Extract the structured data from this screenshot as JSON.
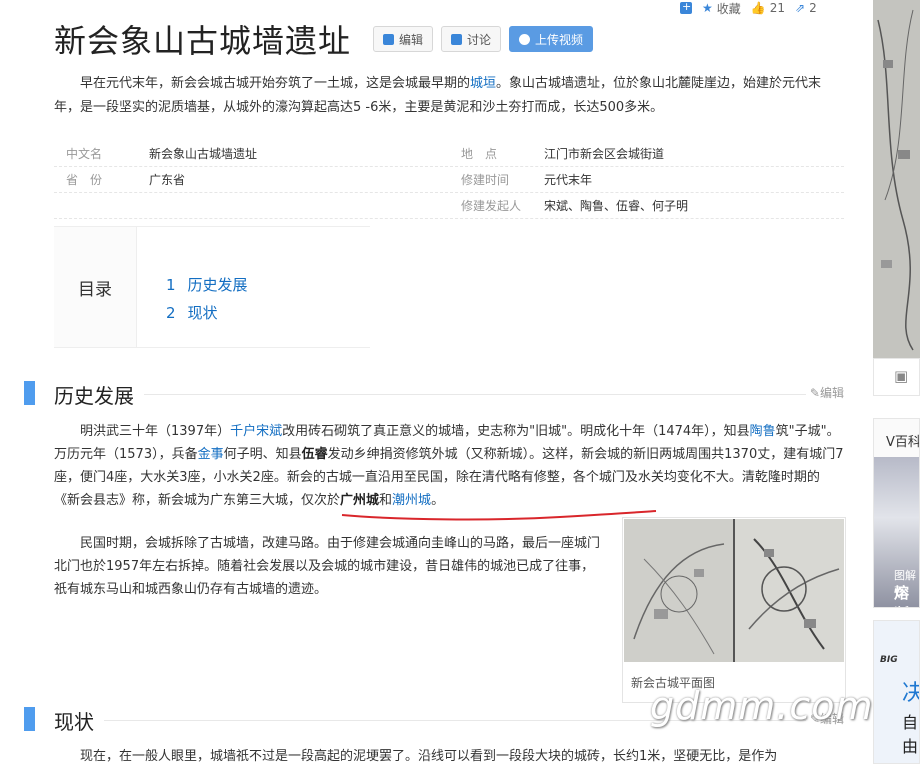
{
  "stats": {
    "favorite_label": "收藏",
    "likes": "21",
    "shares": "2"
  },
  "title": "新会象山古城墙遗址",
  "buttons": {
    "edit": "编辑",
    "discuss": "讨论",
    "upload_video": "上传视频"
  },
  "summary": {
    "before_link": "早在元代末年，新会会城古城开始夯筑了一土城，这是会城最早期的",
    "link": "城垣",
    "after_link": "。象山古城墙遗址，位於象山北麓陡崖边，始建於元代末年，是一段坚实的泥质墙基，从城外的濠沟算起高达5 -6米，主要是黄泥和沙土夯打而成，长达500多米。"
  },
  "info": [
    {
      "k1": "中文名",
      "v1": "新会象山古城墙遗址",
      "k2": "地　点",
      "v2": "江门市新会区会城街道"
    },
    {
      "k1": "省　份",
      "v1": "广东省",
      "k2": "修建时间",
      "v2": "元代末年"
    },
    {
      "k1": "",
      "v1": "",
      "k2": "修建发起人",
      "v2": "宋斌、陶鲁、伍睿、何子明"
    }
  ],
  "toc": {
    "heading": "目录",
    "items": [
      {
        "num": "1",
        "label": "历史发展"
      },
      {
        "num": "2",
        "label": "现状"
      }
    ]
  },
  "sections": {
    "history": "历史发展",
    "status": "现状",
    "edit": "编辑"
  },
  "history_p1": {
    "t1": "明洪武三十年（1397年）",
    "l1": "千户宋斌",
    "t2": "改用砖石砌筑了真正意义的城墙，史志称为\"旧城\"。明成化十年（1474年），知县",
    "l2": "陶鲁",
    "t3": "筑\"子城\"。万历元年（1573），兵备",
    "l3": "金事",
    "t4": "何子明、知县",
    "b1": "伍睿",
    "t5": "发动乡绅捐资修筑外城（又称新城）。这样，新会城的新旧两城周围共1370丈，建有城门7座，便门4座，大水关3座，小水关2座。新会的古城一直沿用至民国，除在清代略有修整，各个城门及水关均变化不大。清乾隆时期的《新会县志》称，新会城为广东第三大城，仅次於",
    "b2": "广州城",
    "t6": "和",
    "l4": "潮州城",
    "t7": "。"
  },
  "history_p2": "民国时期，会城拆除了古城墙，改建马路。由于修建会城通向圭峰山的马路，最后一座城门北门也於1957年左右拆掉。随着社会发展以及会城的城市建设，昔日雄伟的城池已成了往事，祇有城东马山和城西象山仍存有古城墙的遗迹。",
  "figure_caption": "新会古城平面图",
  "status_p1": "现在，在一般人眼里，城墙祇不过是一段高起的泥埂罢了。沿线可以看到一段段大块的城砖，长约1米，坚硬无比，是作为",
  "watermark": "gdmm.com",
  "side": {
    "v_title": "V百科",
    "v_cap1": "图解百",
    "v_cap2": "熔断",
    "ad_small": "BIG",
    "ad_big": "决",
    "ad_text": "自由"
  },
  "colors": {
    "accent": "#4f9cee",
    "link": "#136ec2",
    "underline": "#d9262b"
  }
}
